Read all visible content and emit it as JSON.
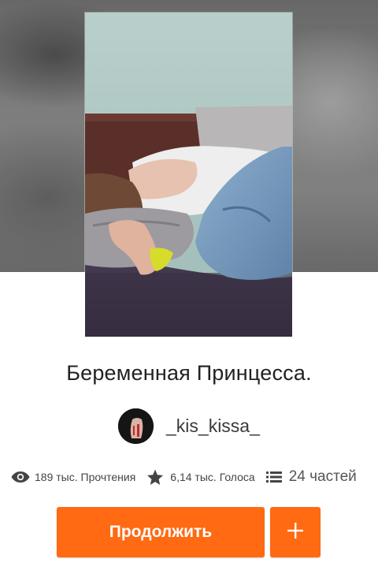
{
  "story": {
    "title": "Беременная Принцесса.",
    "author": "_kis_kissa_"
  },
  "stats": {
    "reads": "189 тыс. Прочтения",
    "votes": "6,14 тыс. Голоса",
    "parts": "24 частей"
  },
  "actions": {
    "continue_label": "Продолжить",
    "add_icon": "plus-icon"
  },
  "icons": {
    "reads": "eye-icon",
    "votes": "star-icon",
    "parts": "list-icon"
  },
  "colors": {
    "accent": "#ff6a12",
    "text": "#222222",
    "muted": "#444444"
  }
}
